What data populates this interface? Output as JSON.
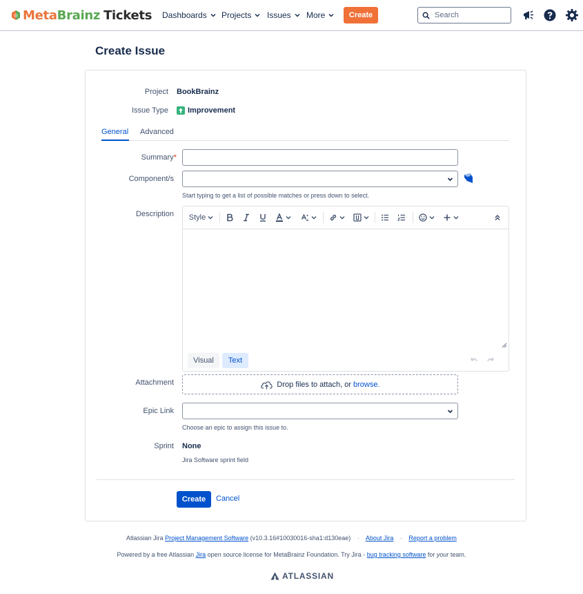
{
  "header": {
    "logo": {
      "part1": "Meta",
      "part2": "Brainz",
      "part3": "Tickets"
    },
    "nav": [
      "Dashboards",
      "Projects",
      "Issues",
      "More"
    ],
    "create_label": "Create",
    "search_placeholder": "Search"
  },
  "page_title": "Create Issue",
  "form": {
    "project_label": "Project",
    "project_value": "BookBrainz",
    "issue_type_label": "Issue Type",
    "issue_type_value": "Improvement",
    "tabs": [
      "General",
      "Advanced"
    ],
    "summary_label": "Summary",
    "summary_required_mark": "*",
    "summary_value": "",
    "components_label": "Component/s",
    "components_value": "",
    "components_hint": "Start typing to get a list of possible matches or press down to select.",
    "description_label": "Description",
    "editor": {
      "style_label": "Style",
      "mode_visual": "Visual",
      "mode_text": "Text",
      "description_value": ""
    },
    "attachment_label": "Attachment",
    "attachment_text": "Drop files to attach, or",
    "attachment_link": "browse.",
    "epic_link_label": "Epic Link",
    "epic_link_value": "",
    "epic_link_hint": "Choose an epic to assign this issue to.",
    "sprint_label": "Sprint",
    "sprint_value": "None",
    "sprint_hint": "Jira Software sprint field",
    "submit_label": "Create",
    "cancel_label": "Cancel"
  },
  "footer": {
    "line1": {
      "prefix": "Atlassian Jira",
      "link_pms": "Project Management Software",
      "version": "(v10.3.16#10030016-sha1:d130eae)",
      "link_about": "About Jira",
      "link_report": "Report a problem"
    },
    "line2": {
      "text_a": "Powered by a free Atlassian",
      "link_jira": "Jira",
      "text_b": "open source license for MetaBrainz Foundation. Try Jira -",
      "link_bug": "bug tracking software",
      "text_c": "for",
      "text_your": "your",
      "text_d": "team."
    },
    "brand": "ATLASSIAN"
  },
  "colors": {
    "brand_orange": "#f07138",
    "primary_blue": "#0052cc",
    "improvement_green": "#36b37e"
  }
}
